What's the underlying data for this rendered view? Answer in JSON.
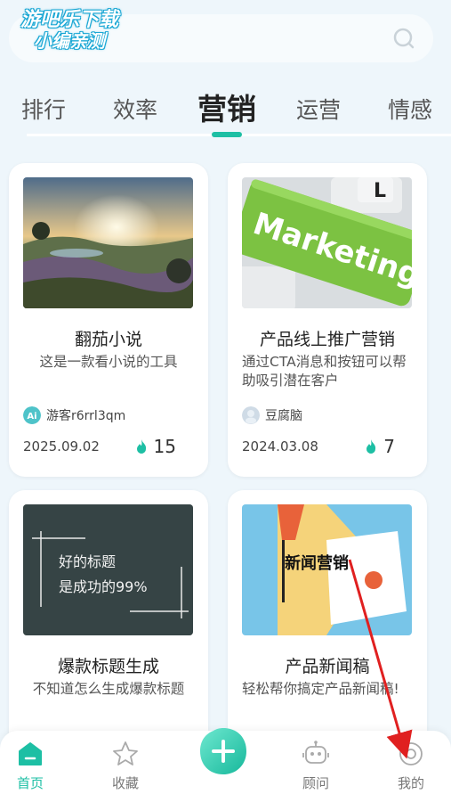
{
  "watermark": {
    "line1": "游吧乐下载",
    "line2": "小编亲测"
  },
  "search": {
    "icon": "search-icon"
  },
  "tabs": [
    {
      "label": "排行"
    },
    {
      "label": "效率"
    },
    {
      "label": "营销",
      "active": true
    },
    {
      "label": "运营"
    },
    {
      "label": "情感"
    }
  ],
  "cards": [
    {
      "title": "翻茄小说",
      "desc": "这是一款看小说的工具",
      "author": "游客r6rrl3qm",
      "date": "2025.09.02",
      "hot": "15"
    },
    {
      "title": "产品线上推广营销",
      "desc": "通过CTA消息和按钮可以帮助吸引潜在客户",
      "author": "豆腐脑",
      "date": "2024.03.08",
      "hot": "7",
      "image_text": "Marketing"
    },
    {
      "title": "爆款标题生成",
      "desc": "不知道怎么生成爆款标题",
      "image_text_line1": "好的标题",
      "image_text_line2": "是成功的99%"
    },
    {
      "title": "产品新闻稿",
      "desc": "轻松帮你搞定产品新闻稿!",
      "image_text": "新闻营销"
    }
  ],
  "nav": {
    "home": "首页",
    "favorites": "收藏",
    "advisor": "顾问",
    "mine": "我的"
  },
  "colors": {
    "accent": "#1dbfa4",
    "background": "#eef6fb",
    "arrow": "#e02020"
  }
}
